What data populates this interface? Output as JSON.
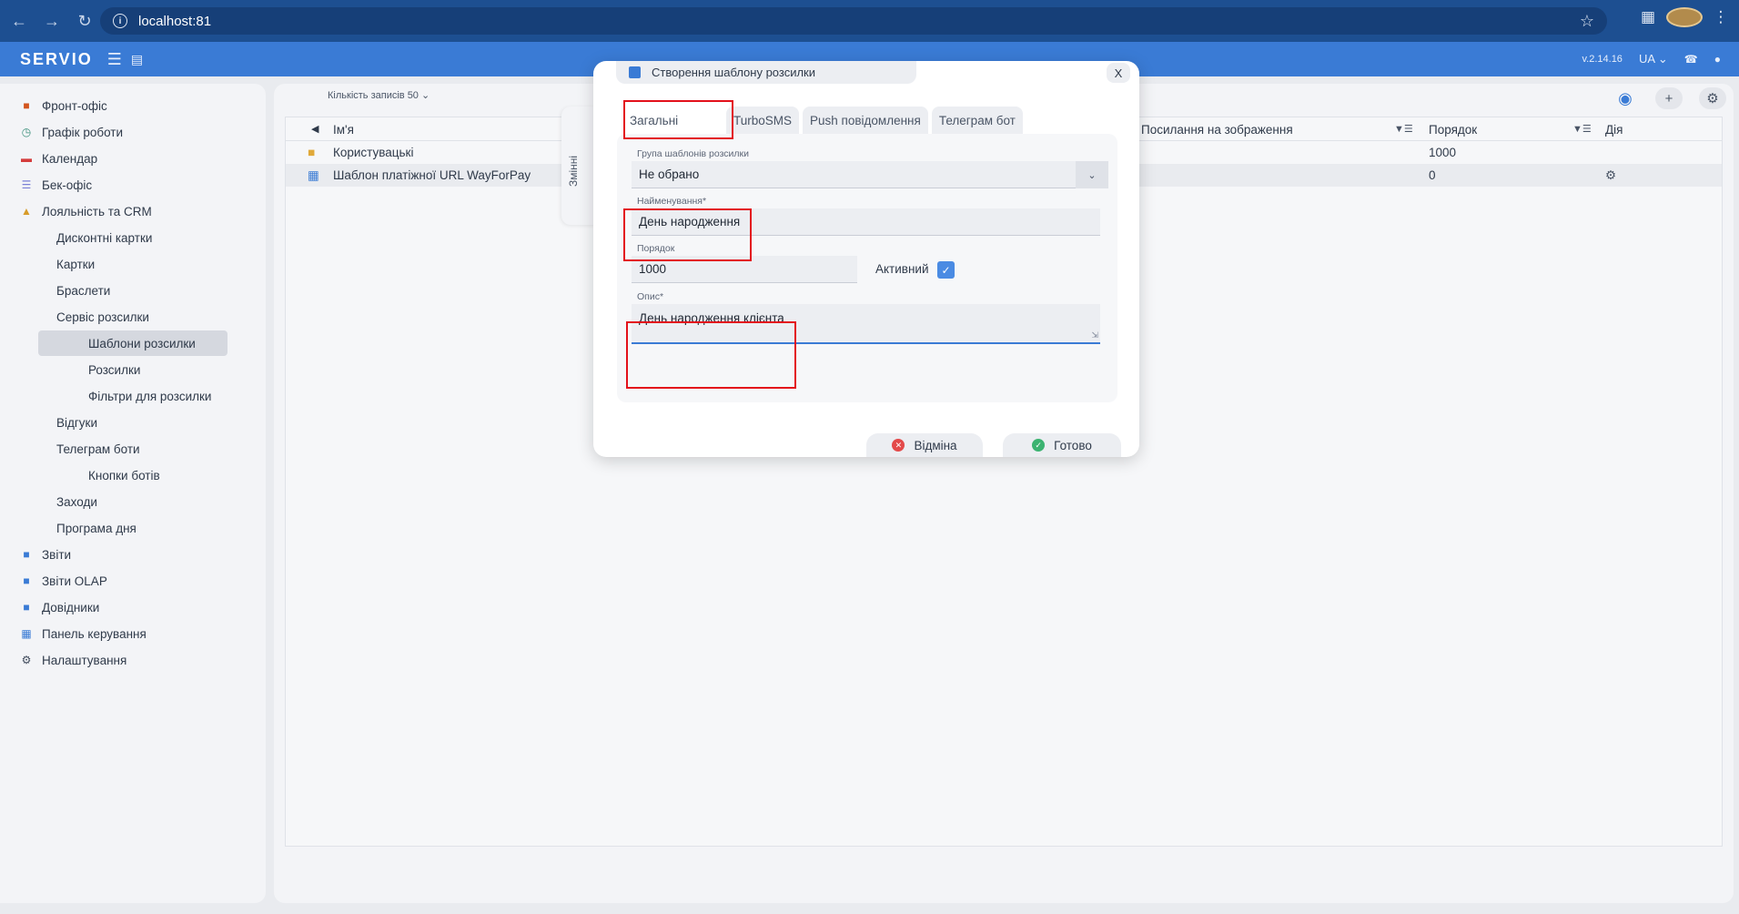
{
  "browser": {
    "url": "localhost:81",
    "back_icon": "arrow-left-icon",
    "forward_icon": "arrow-right-icon",
    "reload_icon": "reload-icon"
  },
  "app": {
    "logo": "SERVIO",
    "version": "v.2.14.16",
    "lang": "UA"
  },
  "sidebar": {
    "items": [
      {
        "label": "Фронт-офіс",
        "icon": "briefcase-icon",
        "color": "#d2551f"
      },
      {
        "label": "Графік роботи",
        "icon": "clock-icon",
        "color": "#3a8f7b"
      },
      {
        "label": "Календар",
        "icon": "calendar-icon",
        "color": "#d43c3c"
      },
      {
        "label": "Бек-офіс",
        "icon": "list-icon",
        "color": "#7a7fd6"
      },
      {
        "label": "Лояльність та CRM",
        "icon": "people-icon",
        "color": "#d79b2a"
      },
      {
        "label": "Дисконтні картки"
      },
      {
        "label": "Картки"
      },
      {
        "label": "Браслети"
      },
      {
        "label": "Сервіс розсилки"
      },
      {
        "label": "Шаблони розсилки"
      },
      {
        "label": "Розсилки"
      },
      {
        "label": "Фільтри для розсилки"
      },
      {
        "label": "Відгуки"
      },
      {
        "label": "Телеграм боти"
      },
      {
        "label": "Кнопки ботів"
      },
      {
        "label": "Заходи"
      },
      {
        "label": "Програма дня"
      },
      {
        "label": "Звіти",
        "icon": "report-icon",
        "color": "#3a7bd5"
      },
      {
        "label": "Звіти OLAP",
        "icon": "olap-icon",
        "color": "#3a7bd5"
      },
      {
        "label": "Довідники",
        "icon": "book-icon",
        "color": "#3a7bd5"
      },
      {
        "label": "Панель керування",
        "icon": "panel-icon",
        "color": "#3a7bd5"
      },
      {
        "label": "Налаштування",
        "icon": "gear-icon",
        "color": "#3f4a5c"
      }
    ]
  },
  "main": {
    "records_label": "Кількість записів  50",
    "columns": {
      "name": "Ім'я",
      "image_link": "Посилання на зображення",
      "order": "Порядок",
      "action": "Дія"
    },
    "rows": [
      {
        "name": "Користувацькі",
        "order": "1000",
        "icon": "folder-icon"
      },
      {
        "name": "Шаблон платіжної URL WayForPay",
        "order": "0",
        "icon": "template-icon"
      }
    ]
  },
  "side_tab": {
    "label": "Змінні"
  },
  "modal": {
    "title": "Створення шаблону розсилки",
    "close_label": "X",
    "tabs": [
      "Загальні",
      "TurboSMS",
      "Push повідомлення",
      "Телеграм бот"
    ],
    "group_label": "Група шаблонів розсилки",
    "group_value": "Не обрано",
    "name_label": "Найменування*",
    "name_value": "День народження",
    "order_label": "Порядок",
    "order_value": "1000",
    "active_label": "Активний",
    "description_label": "Опис*",
    "description_value": "День народження клієнта",
    "cancel_label": "Відміна",
    "done_label": "Готово"
  }
}
